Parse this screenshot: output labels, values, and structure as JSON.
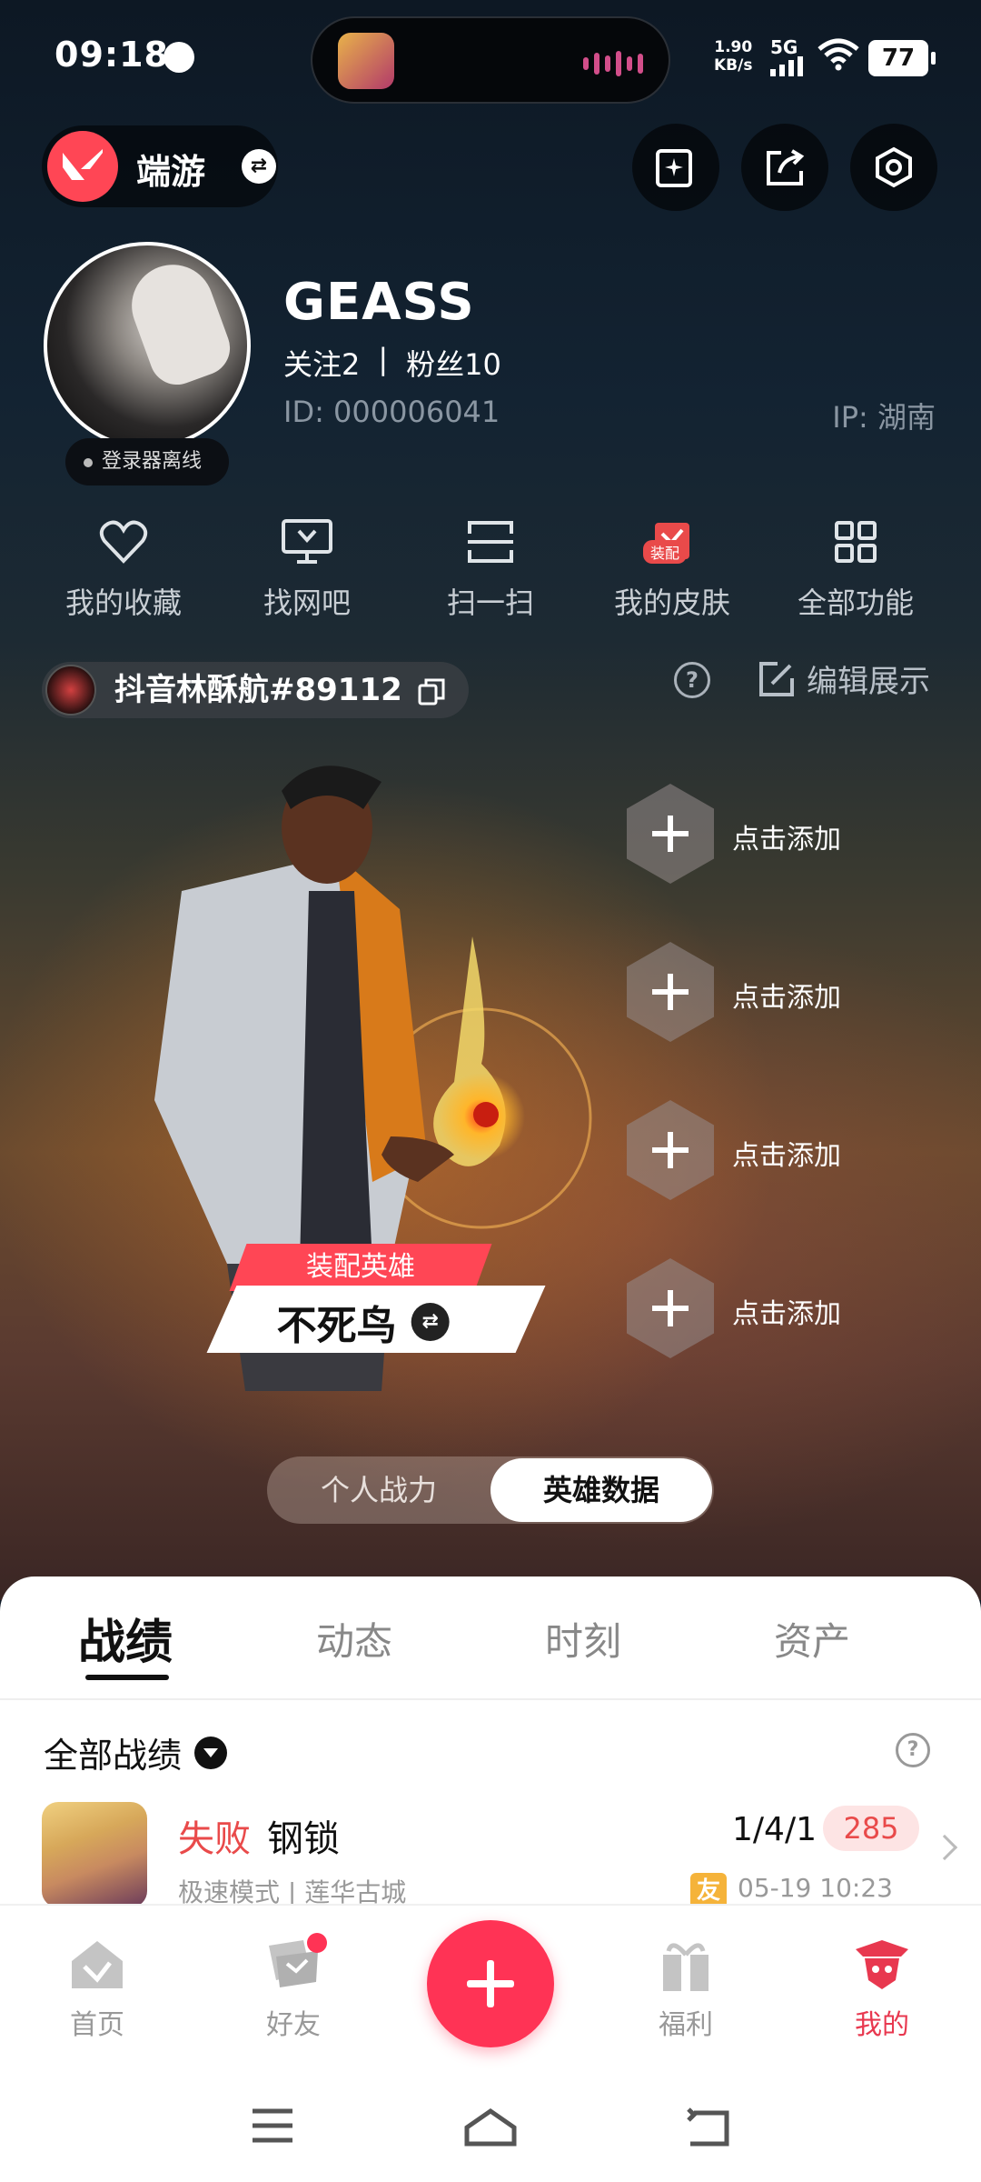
{
  "status_bar": {
    "time": "09:18",
    "net_speed_value": "1.90",
    "net_speed_unit": "KB/s",
    "network": "5G",
    "battery": "77"
  },
  "header": {
    "game_name": "端游",
    "swap_symbol": "⇄",
    "icons": [
      "add-sparkle-icon",
      "share-icon",
      "settings-hex-icon"
    ]
  },
  "profile": {
    "username": "GEASS",
    "follow_label": "关注",
    "follow_count": "2",
    "separator": "|",
    "fans_label": "粉丝",
    "fans_count": "10",
    "id_text": "ID:  000006041",
    "ip_text": "IP:  湖南",
    "launcher_status": "登录器离线"
  },
  "quick_menu": [
    {
      "label": "我的收藏",
      "icon": "heart-icon"
    },
    {
      "label": "找网吧",
      "icon": "monitor-icon"
    },
    {
      "label": "扫一扫",
      "icon": "scan-icon"
    },
    {
      "label": "我的皮肤",
      "icon": "skin-icon",
      "badge": "装配"
    },
    {
      "label": "全部功能",
      "icon": "grid-icon"
    }
  ],
  "riot_id": {
    "text": "抖音林酥航#89112"
  },
  "showcase": {
    "edit_label": "编辑展示",
    "help": "?",
    "slots": [
      {
        "label": "点击添加"
      },
      {
        "label": "点击添加"
      },
      {
        "label": "点击添加"
      },
      {
        "label": "点击添加"
      }
    ],
    "equip_tag": "装配英雄",
    "equip_hero": "不死鸟",
    "segment": {
      "left": "个人战力",
      "right": "英雄数据",
      "selected": "英雄数据"
    }
  },
  "sheet": {
    "tabs": [
      "战绩",
      "动态",
      "时刻",
      "资产"
    ],
    "active_tab": "战绩",
    "filter_label": "全部战绩",
    "help": "?",
    "matches": [
      {
        "result": "失败",
        "agent": "钢锁",
        "kda": "1/4/1",
        "score": "285",
        "mode": "极速模式 | 莲华古城",
        "friend_badge": "友",
        "date": "05-19 10:23"
      }
    ]
  },
  "bottom_nav": [
    {
      "label": "首页",
      "icon": "home-icon"
    },
    {
      "label": "好友",
      "icon": "friends-icon"
    },
    {
      "label": "福利",
      "icon": "gift-icon"
    },
    {
      "label": "我的",
      "icon": "profile-icon",
      "active": true
    }
  ],
  "colors": {
    "accent": "#ff3355",
    "valorant_red": "#ff4655",
    "loss_red": "#e94a4a",
    "friend_badge": "#f5b33a"
  }
}
